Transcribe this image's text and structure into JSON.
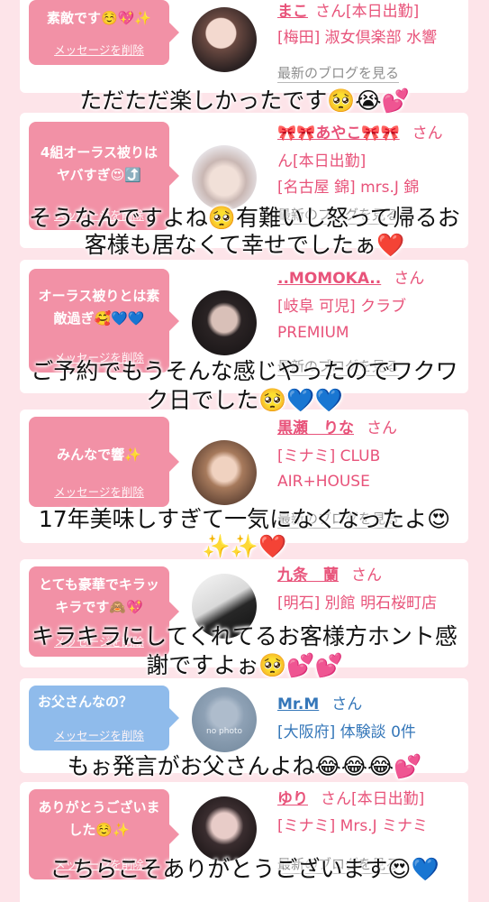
{
  "delete_label": "メッセージを削除",
  "blog_label": "最新のブログを見る",
  "san_label": "さん",
  "cards": [
    {
      "message": "素敵です☺️💖✨",
      "name": "まこ",
      "shop": "[本日出勤]",
      "shop2": "[梅田] 淑女倶楽部 水響",
      "caption": "ただただ楽しかったです🥺😭💕"
    },
    {
      "message": "4組オーラス被りはヤバすぎ😍⤴️",
      "name": "🎀🎀あやこ🎀🎀",
      "shop": "ん[本日出勤]",
      "shop2": "[名古屋 錦] mrs.J 錦",
      "caption": "そうなんですよね🥺有難いし怒って帰るお",
      "caption2": "客様も居なくて幸せでしたぁ❤️"
    },
    {
      "message": "オーラス被りとは素敵過ぎ🥰💙💙",
      "name": "..MOMOKA..",
      "shop": "[岐阜 可児] クラブ",
      "shop2": "PREMIUM",
      "caption": "ご予約でもうそんな感じやったのでワクワ",
      "caption2": "ク日でした🥺💙💙"
    },
    {
      "message": "みんなで響✨",
      "name": "黒瀬　りな",
      "shop": "[ミナミ] CLUB",
      "shop2": "AIR+HOUSE",
      "caption": "17年美味しすぎて一気になくなったよ😍",
      "caption2": "✨✨❤️"
    },
    {
      "message": "とても豪華でキラッキラです🙈💖",
      "name": "九条　蘭",
      "shop": "[明石] 別館 明石桜町店",
      "caption": "キラキラにしてくれてるお客様方ホント感",
      "caption2": "謝ですよぉ🥺💕💕"
    },
    {
      "message": "お父さんなの？",
      "name": "Mr.M",
      "shop": "[大阪府] 体験談 0件",
      "avatar_text": "no photo",
      "caption": "もぉ発言がお父さんよね😂😂😂💕"
    },
    {
      "message": "ありがとうございました☺️✨",
      "name": "ゆり",
      "shop": "[本日出勤]",
      "shop2": "[ミナミ] Mrs.J ミナミ",
      "caption": "こちらこそありがとうございます😍💙"
    }
  ]
}
